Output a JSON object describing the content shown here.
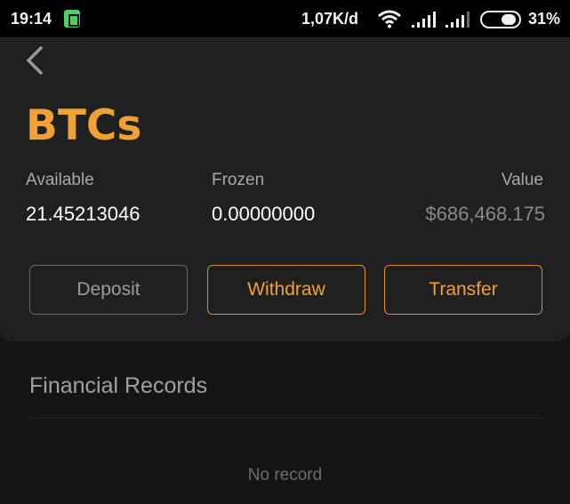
{
  "status_bar": {
    "time": "19:14",
    "network_speed": "1,07K/d",
    "battery_percent": "31%",
    "icons": [
      "battery-saver-icon",
      "wifi-icon",
      "signal-icon",
      "signal-icon",
      "battery-icon"
    ]
  },
  "header": {
    "back_icon": "chevron-left-icon",
    "title": "BTCs"
  },
  "balances": {
    "available_label": "Available",
    "available_value": "21.45213046",
    "frozen_label": "Frozen",
    "frozen_value": "0.00000000",
    "value_label": "Value",
    "value_amount": "$686,468.175"
  },
  "actions": {
    "deposit": "Deposit",
    "withdraw": "Withdraw",
    "transfer": "Transfer"
  },
  "records": {
    "title": "Financial Records",
    "empty_text": "No record"
  },
  "colors": {
    "accent": "#f0a136",
    "background": "#171717",
    "card": "#202020",
    "muted_text": "#a9a9a9"
  }
}
